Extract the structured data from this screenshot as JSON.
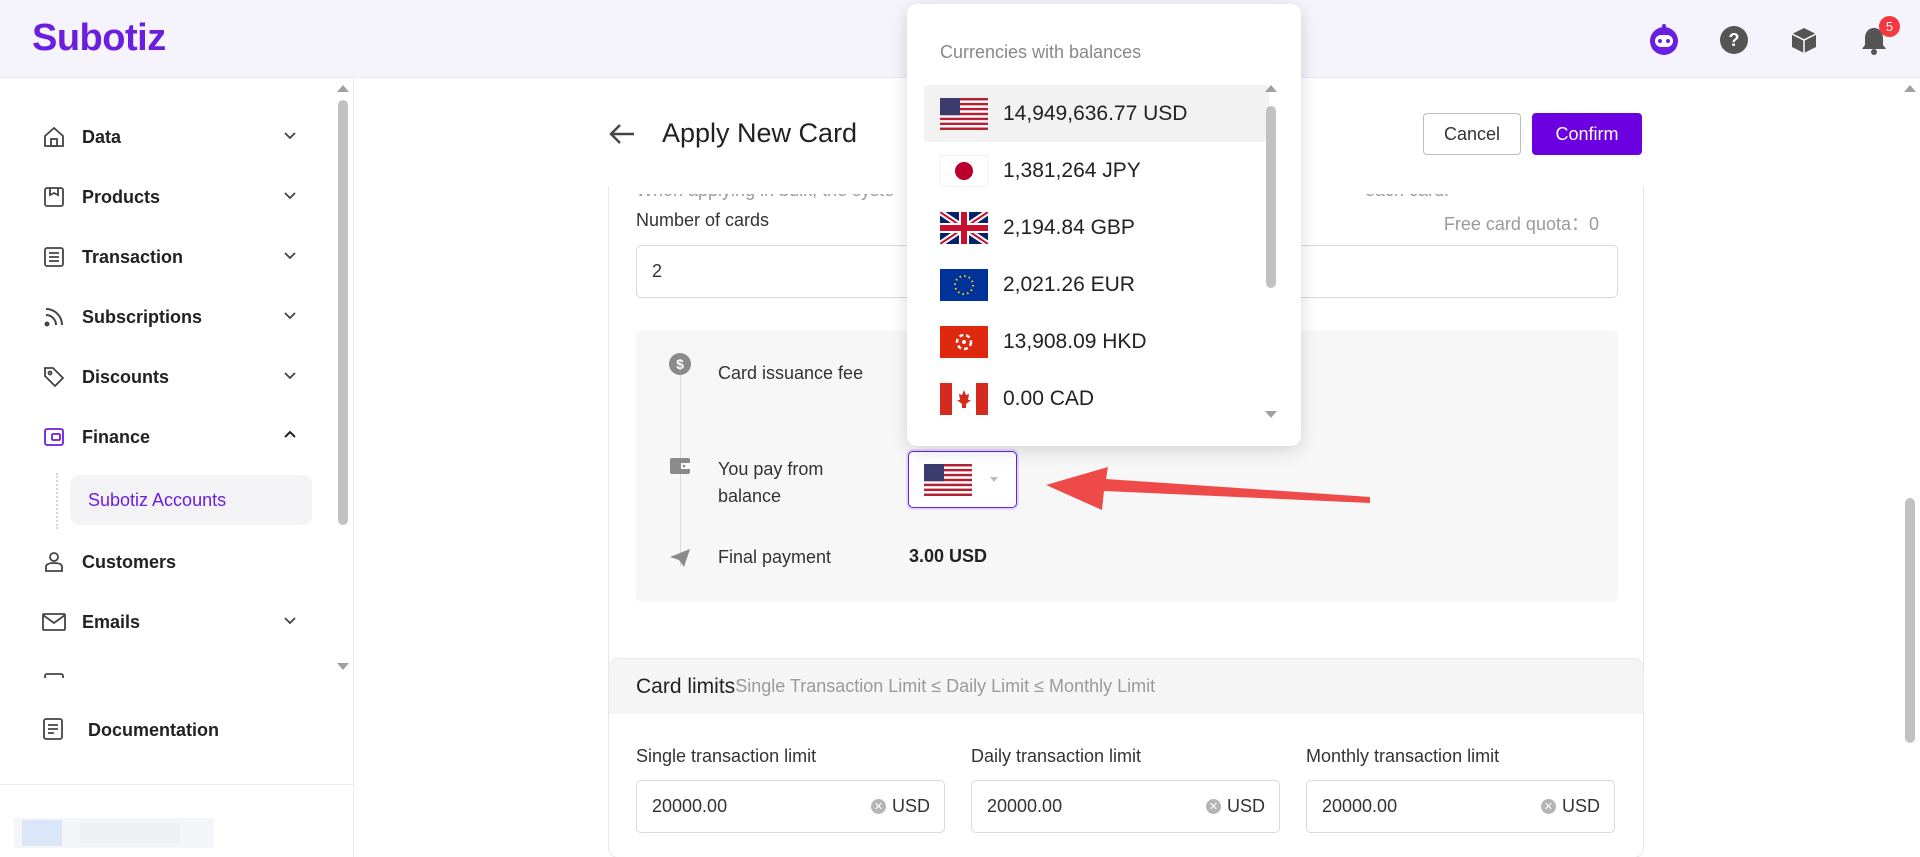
{
  "app": {
    "logo": "Subotiz",
    "notification_count": "5",
    "brand_color": "#6b00e0"
  },
  "sidebar": {
    "items": [
      {
        "label": "Data",
        "icon": "home-icon",
        "expandable": true
      },
      {
        "label": "Products",
        "icon": "product-icon",
        "expandable": true
      },
      {
        "label": "Transaction",
        "icon": "list-icon",
        "expandable": true
      },
      {
        "label": "Subscriptions",
        "icon": "rss-icon",
        "expandable": true
      },
      {
        "label": "Discounts",
        "icon": "tag-icon",
        "expandable": true
      },
      {
        "label": "Finance",
        "icon": "wallet-icon",
        "expanded": true
      },
      {
        "label": "Customers",
        "icon": "user-icon",
        "expandable": false
      },
      {
        "label": "Emails",
        "icon": "mail-icon",
        "expandable": true
      }
    ],
    "sub_item": "Subotiz Accounts",
    "documentation": "Documentation"
  },
  "page": {
    "title": "Apply New Card",
    "cancel_label": "Cancel",
    "confirm_label": "Confirm",
    "hint_left": "When applying in bulk, the syste",
    "hint_right": "each card.",
    "cards_label": "Number of cards",
    "cards_value": "2",
    "quota": "Free card quota：0",
    "fee_label": "Card issuance fee",
    "pay_label": "You pay from balance",
    "final_label": "Final payment",
    "final_value": "3.00 USD",
    "selected_currency": "USD"
  },
  "limits": {
    "title": "Card limits",
    "subtitle": "Single Transaction Limit ≤ Daily Limit ≤ Monthly Limit",
    "fields": [
      {
        "label": "Single transaction limit",
        "value": "20000.00",
        "unit": "USD"
      },
      {
        "label": "Daily transaction limit",
        "value": "20000.00",
        "unit": "USD"
      },
      {
        "label": "Monthly transaction limit",
        "value": "20000.00",
        "unit": "USD"
      }
    ]
  },
  "dropdown": {
    "title": "Currencies with balances",
    "options": [
      {
        "label": "14,949,636.77 USD",
        "flag": "us-flag-icon",
        "selected": true
      },
      {
        "label": "1,381,264 JPY",
        "flag": "jp-flag-icon"
      },
      {
        "label": "2,194.84 GBP",
        "flag": "gb-flag-icon"
      },
      {
        "label": "2,021.26 EUR",
        "flag": "eu-flag-icon"
      },
      {
        "label": "13,908.09 HKD",
        "flag": "hk-flag-icon"
      },
      {
        "label": "0.00 CAD",
        "flag": "ca-flag-icon"
      }
    ]
  }
}
